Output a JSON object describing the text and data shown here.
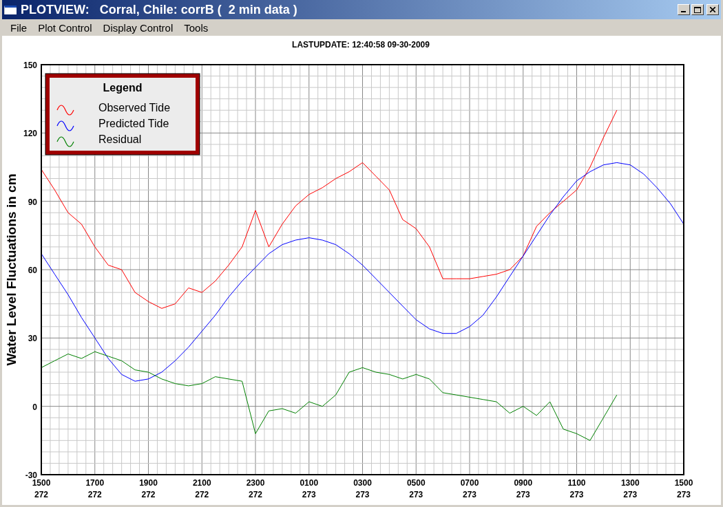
{
  "window": {
    "title": "PLOTVIEW:   Corral, Chile: corrB (  2 min data )"
  },
  "menu": [
    "File",
    "Plot Control",
    "Display Control",
    "Tools"
  ],
  "last_update": "LASTUPDATE: 12:40:58  09-30-2009",
  "chart_data": {
    "type": "line",
    "grid": true,
    "legend": {
      "title": "Legend"
    },
    "ylabel": "Water Level Fluctuations in cm",
    "categories": [
      "1500\n272",
      null,
      null,
      null,
      "1700\n272",
      null,
      null,
      null,
      "1900\n272",
      null,
      null,
      null,
      "2100\n272",
      null,
      null,
      null,
      "2300\n272",
      null,
      null,
      null,
      "0100\n273",
      null,
      null,
      null,
      "0300\n273",
      null,
      null,
      null,
      "0500\n273",
      null,
      null,
      null,
      "0700\n273",
      null,
      null,
      null,
      "0900\n273",
      null,
      null,
      null,
      "1100\n273",
      null,
      null,
      null,
      "1300\n273",
      null,
      null,
      null,
      "1500\n273"
    ],
    "series": [
      {
        "name": "Observed Tide",
        "color": "#ff0000",
        "values": [
          104,
          95,
          85,
          80,
          70,
          62,
          60,
          50,
          46,
          43,
          45,
          52,
          50,
          55,
          62,
          70,
          86,
          70,
          80,
          88,
          93,
          96,
          100,
          103,
          107,
          101,
          95,
          82,
          78,
          70,
          56,
          56,
          56,
          57,
          58,
          60,
          66,
          79,
          85,
          90,
          95,
          105,
          118,
          130,
          null,
          null,
          null,
          null,
          null
        ]
      },
      {
        "name": "Predicted Tide",
        "color": "#0000ff",
        "values": [
          67,
          58,
          49,
          39,
          30,
          21,
          14,
          11,
          12,
          15,
          20,
          26,
          33,
          40,
          48,
          55,
          61,
          67,
          71,
          73,
          74,
          73,
          71,
          67,
          62,
          56,
          50,
          44,
          38,
          34,
          32,
          32,
          35,
          40,
          48,
          57,
          66,
          75,
          84,
          92,
          99,
          103,
          106,
          107,
          106,
          102,
          96,
          89,
          80
        ]
      },
      {
        "name": "Residual",
        "color": "#008000",
        "values": [
          17,
          20,
          23,
          21,
          24,
          22,
          20,
          16,
          15,
          12,
          10,
          9,
          10,
          13,
          12,
          11,
          -12,
          -2,
          -1,
          -3,
          2,
          0,
          5,
          15,
          17,
          15,
          14,
          12,
          14,
          12,
          6,
          5,
          4,
          3,
          2,
          -3,
          0,
          -4,
          2,
          -10,
          -12,
          -15,
          -5,
          5,
          null,
          null,
          null,
          null,
          null
        ]
      }
    ],
    "ylim": [
      -30,
      150
    ],
    "yticks": [
      -30,
      0,
      30,
      60,
      90,
      120,
      150
    ]
  }
}
